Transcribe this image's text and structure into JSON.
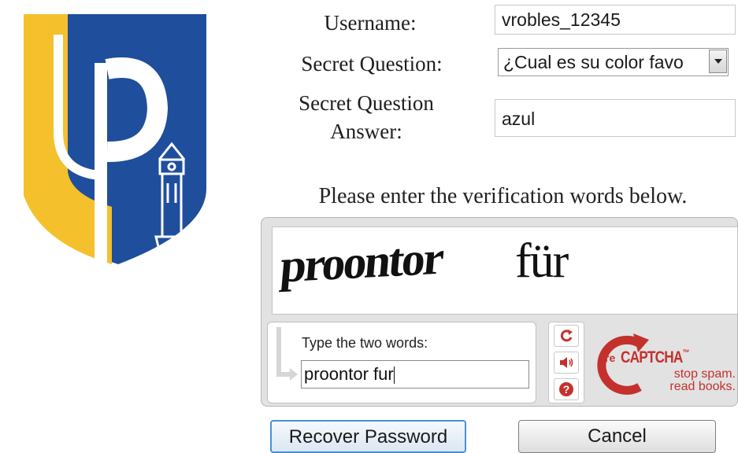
{
  "form": {
    "username_label": "Username:",
    "username_value": "vrobles_12345",
    "question_label": "Secret Question:",
    "question_value": "¿Cual es su color favo",
    "answer_label_line1": "Secret Question",
    "answer_label_line2": "Answer:",
    "answer_value": "azul"
  },
  "captcha": {
    "instruction": "Please enter the verification words below.",
    "word1": "proontor",
    "word2": "für",
    "prompt": "Type the two words:",
    "input_value": "proontor fur",
    "brand_re": "re",
    "brand_name": "CAPTCHA",
    "brand_tm": "™",
    "tagline_line1": "stop spam.",
    "tagline_line2": "read books."
  },
  "buttons": {
    "recover": "Recover Password",
    "cancel": "Cancel"
  },
  "colors": {
    "logo_blue": "#1f4e9c",
    "logo_gold": "#f4c02c",
    "recaptcha_red": "#c4312c"
  },
  "icons": {
    "refresh": "refresh-icon",
    "audio": "audio-icon",
    "help": "help-icon",
    "logo": "university-shield-logo"
  }
}
